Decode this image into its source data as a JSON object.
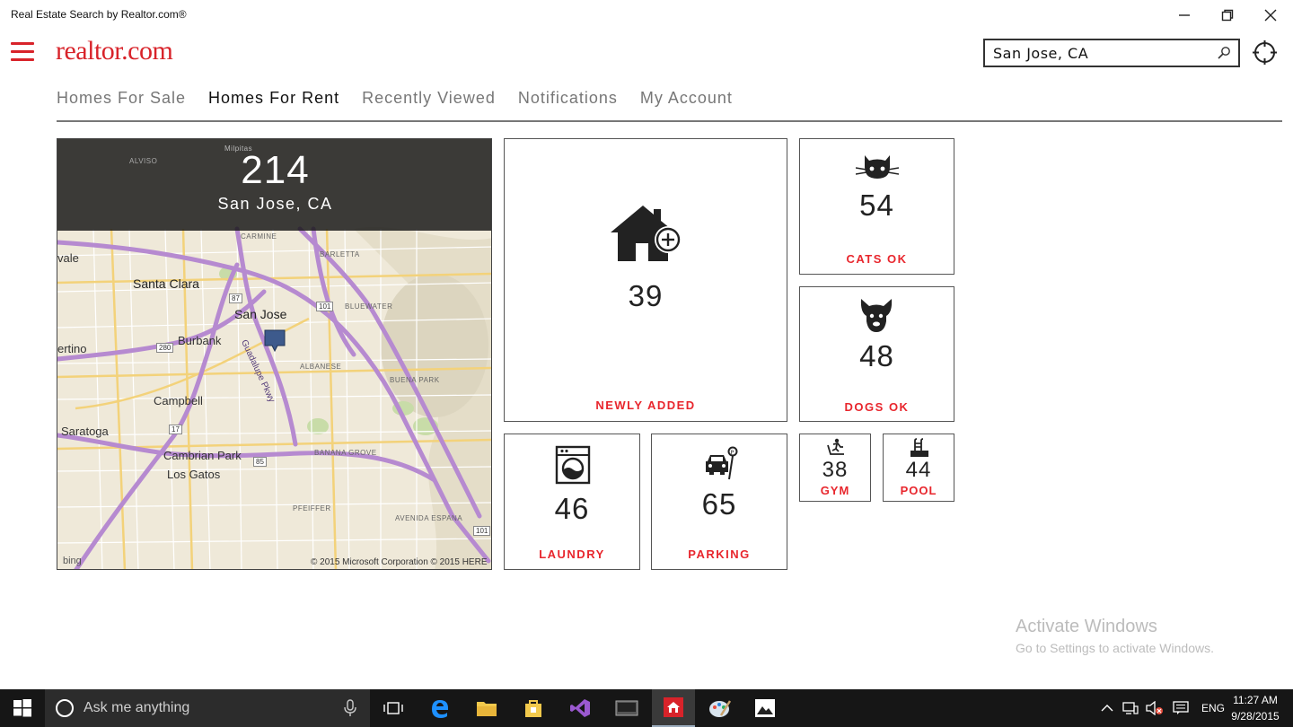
{
  "window": {
    "title": "Real Estate Search by Realtor.com®",
    "controls": [
      "minimize",
      "restore",
      "close"
    ]
  },
  "header": {
    "logo_text": "realtor.com",
    "search": {
      "value": "San Jose, CA"
    }
  },
  "tabs": [
    {
      "label": "Homes For Sale",
      "active": false
    },
    {
      "label": "Homes For Rent",
      "active": true
    },
    {
      "label": "Recently Viewed",
      "active": false
    },
    {
      "label": "Notifications",
      "active": false
    },
    {
      "label": "My Account",
      "active": false
    }
  ],
  "map_tile": {
    "count": "214",
    "city": "San Jose, CA",
    "labels": {
      "milpitas": "Milpitas",
      "alviso": "ALVISO",
      "carmine": "CARMINE",
      "barletta": "BARLETTA",
      "vale": "vale",
      "santa_clara": "Santa Clara",
      "san_jose": "San Jose",
      "bluewater": "BLUEWATER",
      "burbank": "Burbank",
      "ertino": "ertino",
      "albanese": "ALBANESE",
      "guadalupe": "Guadalupe Pkwy",
      "buena_park": "BUENA PARK",
      "campbell": "Campbell",
      "saratoga": "Saratoga",
      "cambrian_park": "Cambrian Park",
      "los_gatos": "Los Gatos",
      "banana_grove": "BANANA GROVE",
      "pfeiffer": "PFEIFFER",
      "avenida_espana": "AVENIDA ESPANA",
      "shield_87": "87",
      "shield_101a": "101",
      "shield_280": "280",
      "shield_17": "17",
      "shield_85": "85",
      "shield_101b": "101"
    },
    "bing": "bing",
    "copyright": "© 2015 Microsoft Corporation © 2015 HERE"
  },
  "tiles": {
    "newly_added": {
      "count": "39",
      "label": "NEWLY ADDED",
      "icon": "house-plus-icon"
    },
    "cats_ok": {
      "count": "54",
      "label": "CATS OK",
      "icon": "cat-icon"
    },
    "dogs_ok": {
      "count": "48",
      "label": "DOGS OK",
      "icon": "dog-icon"
    },
    "laundry": {
      "count": "46",
      "label": "LAUNDRY",
      "icon": "washing-machine-icon"
    },
    "parking": {
      "count": "65",
      "label": "PARKING",
      "icon": "car-parking-icon"
    },
    "gym": {
      "count": "38",
      "label": "GYM",
      "icon": "treadmill-icon"
    },
    "pool": {
      "count": "44",
      "label": "POOL",
      "icon": "pool-icon"
    }
  },
  "colors": {
    "brand_red": "#d8232a",
    "tile_label_red": "#e8262d",
    "taskbar": "#161616"
  },
  "watermark": {
    "line1": "Activate Windows",
    "line2": "Go to Settings to activate Windows."
  },
  "taskbar": {
    "search_placeholder": "Ask me anything",
    "apps": [
      "task-view-icon",
      "edge-icon",
      "file-explorer-icon",
      "store-icon",
      "visual-studio-icon",
      "terminal-icon",
      "realtor-app-icon",
      "paint-icon",
      "photos-icon"
    ],
    "language": "ENG",
    "time": "11:27 AM",
    "date": "9/28/2015"
  }
}
